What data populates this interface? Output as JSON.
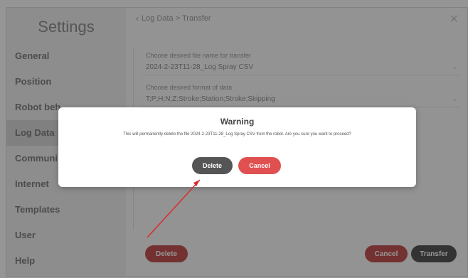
{
  "sidebar": {
    "title": "Settings",
    "items": [
      {
        "label": "General"
      },
      {
        "label": "Position"
      },
      {
        "label": "Robot beh"
      },
      {
        "label": "Log Data"
      },
      {
        "label": "Communi"
      },
      {
        "label": "Internet"
      },
      {
        "label": "Templates"
      },
      {
        "label": "User"
      },
      {
        "label": "Help"
      }
    ],
    "active_index": 3
  },
  "main": {
    "breadcrumb": "Log Data > Transfer",
    "filename_label": "Choose desired file name for transfer",
    "filename_value": "2024-2-23T11-28_Log Spray CSV",
    "format_label": "Choose desired format of data",
    "format_value": "T;P;H;N;Z;Stroke;Station;Stroke;Skipping",
    "delete_label": "Delete",
    "cancel_label": "Cancel",
    "transfer_label": "Transfer"
  },
  "dialog": {
    "title": "Warning",
    "message": "This will permanently delete the file 2024-2-23T11-28_Log Spray CSV from the robot. Are you sure you want to proceed?",
    "delete_label": "Delete",
    "cancel_label": "Cancel"
  },
  "colors": {
    "overlay": "#141414",
    "danger": "#e05050",
    "annotation_arrow": "#d62d2d"
  },
  "icons": [
    "chevron-left-icon",
    "close-icon",
    "dropdown-arrow-icon"
  ]
}
